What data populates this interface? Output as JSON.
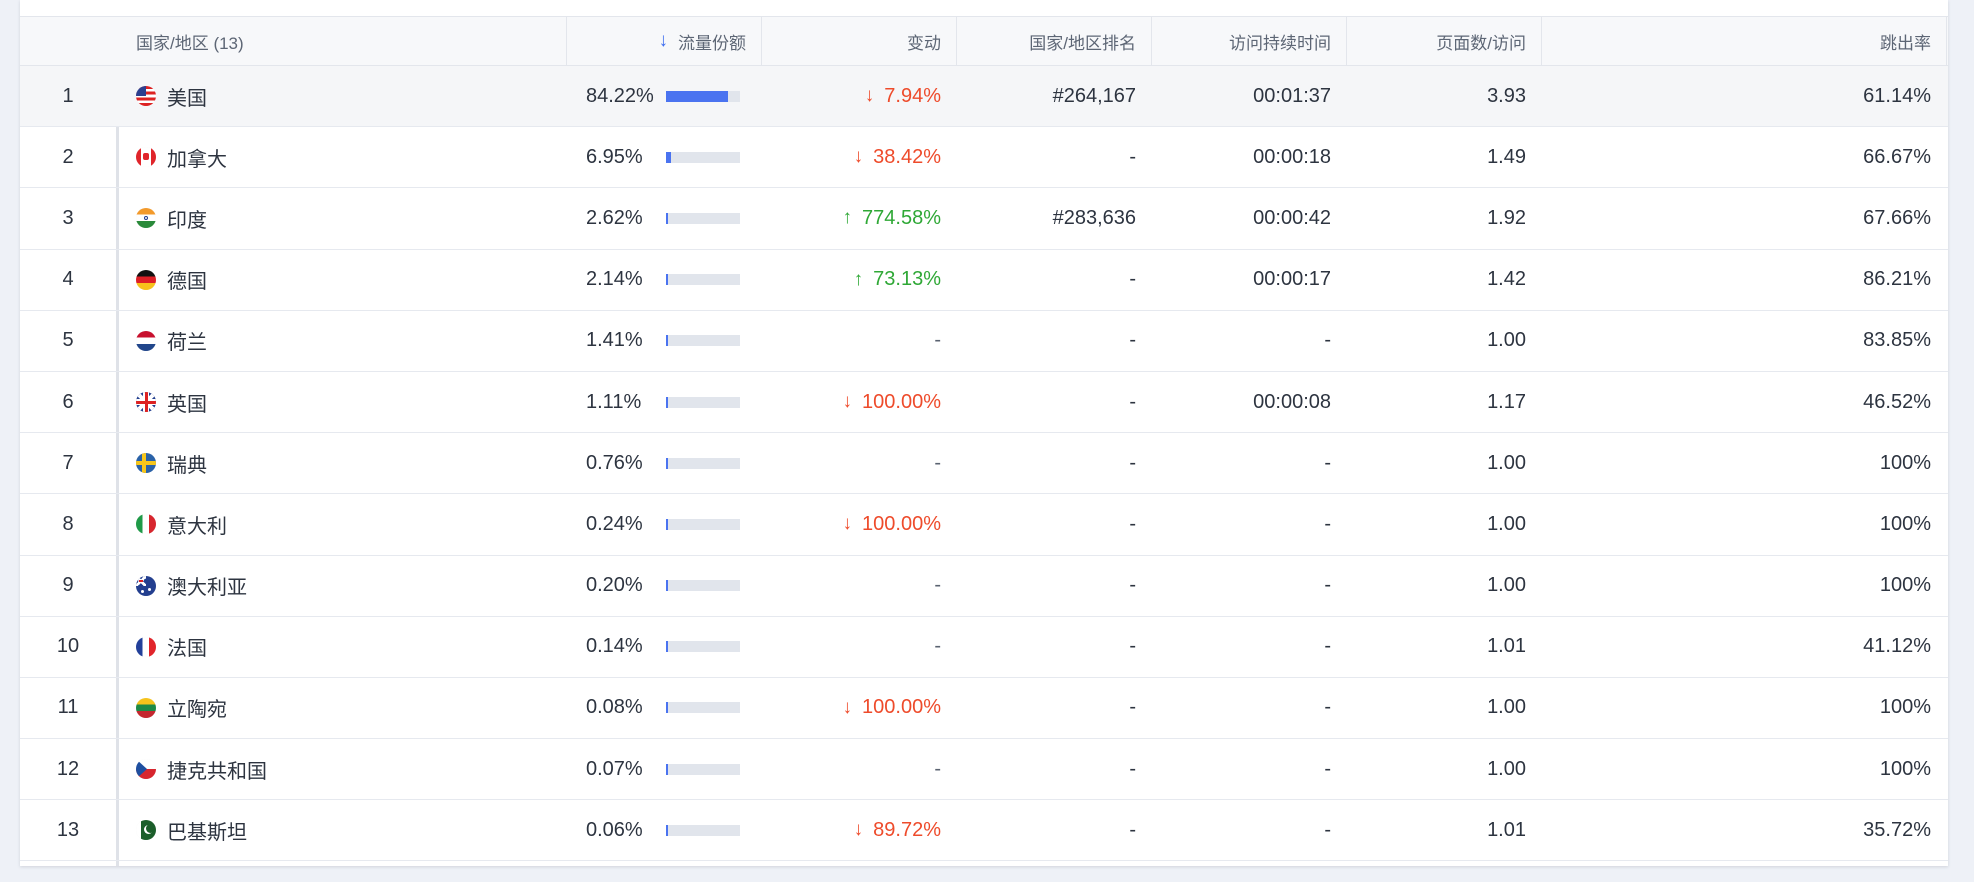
{
  "table": {
    "headers": {
      "country": "国家/地区 (13)",
      "traffic_share": "流量份额",
      "change": "变动",
      "country_rank": "国家/地区排名",
      "visit_duration": "访问持续时间",
      "pages_per_visit": "页面数/访问",
      "bounce_rate": "跳出率"
    },
    "sort_icon": "arrow-down-icon",
    "colors": {
      "bar": "#4a73f0",
      "down": "#ee4b2b",
      "up": "#2fa836"
    },
    "rows": [
      {
        "rank": "1",
        "country": "美国",
        "flag": "us-flag-icon",
        "share": "84.22%",
        "share_value": 84.22,
        "change": "7.94%",
        "dir": "down",
        "country_rank": "#264,167",
        "duration": "00:01:37",
        "pages": "3.93",
        "bounce": "61.14%"
      },
      {
        "rank": "2",
        "country": "加拿大",
        "flag": "canada-flag-icon",
        "share": "6.95%",
        "share_value": 6.95,
        "change": "38.42%",
        "dir": "down",
        "country_rank": "-",
        "duration": "00:00:18",
        "pages": "1.49",
        "bounce": "66.67%"
      },
      {
        "rank": "3",
        "country": "印度",
        "flag": "india-flag-icon",
        "share": "2.62%",
        "share_value": 2.62,
        "change": "774.58%",
        "dir": "up",
        "country_rank": "#283,636",
        "duration": "00:00:42",
        "pages": "1.92",
        "bounce": "67.66%"
      },
      {
        "rank": "4",
        "country": "德国",
        "flag": "germany-flag-icon",
        "share": "2.14%",
        "share_value": 2.14,
        "change": "73.13%",
        "dir": "up",
        "country_rank": "-",
        "duration": "00:00:17",
        "pages": "1.42",
        "bounce": "86.21%"
      },
      {
        "rank": "5",
        "country": "荷兰",
        "flag": "netherlands-flag-icon",
        "share": "1.41%",
        "share_value": 1.41,
        "change": "-",
        "dir": "none",
        "country_rank": "-",
        "duration": "-",
        "pages": "1.00",
        "bounce": "83.85%"
      },
      {
        "rank": "6",
        "country": "英国",
        "flag": "uk-flag-icon",
        "share": "1.11%",
        "share_value": 1.11,
        "change": "100.00%",
        "dir": "down",
        "country_rank": "-",
        "duration": "00:00:08",
        "pages": "1.17",
        "bounce": "46.52%"
      },
      {
        "rank": "7",
        "country": "瑞典",
        "flag": "sweden-flag-icon",
        "share": "0.76%",
        "share_value": 0.76,
        "change": "-",
        "dir": "none",
        "country_rank": "-",
        "duration": "-",
        "pages": "1.00",
        "bounce": "100%"
      },
      {
        "rank": "8",
        "country": "意大利",
        "flag": "italy-flag-icon",
        "share": "0.24%",
        "share_value": 0.24,
        "change": "100.00%",
        "dir": "down",
        "country_rank": "-",
        "duration": "-",
        "pages": "1.00",
        "bounce": "100%"
      },
      {
        "rank": "9",
        "country": "澳大利亚",
        "flag": "australia-flag-icon",
        "share": "0.20%",
        "share_value": 0.2,
        "change": "-",
        "dir": "none",
        "country_rank": "-",
        "duration": "-",
        "pages": "1.00",
        "bounce": "100%"
      },
      {
        "rank": "10",
        "country": "法国",
        "flag": "france-flag-icon",
        "share": "0.14%",
        "share_value": 0.14,
        "change": "-",
        "dir": "none",
        "country_rank": "-",
        "duration": "-",
        "pages": "1.01",
        "bounce": "41.12%"
      },
      {
        "rank": "11",
        "country": "立陶宛",
        "flag": "lithuania-flag-icon",
        "share": "0.08%",
        "share_value": 0.08,
        "change": "100.00%",
        "dir": "down",
        "country_rank": "-",
        "duration": "-",
        "pages": "1.00",
        "bounce": "100%"
      },
      {
        "rank": "12",
        "country": "捷克共和国",
        "flag": "czech-flag-icon",
        "share": "0.07%",
        "share_value": 0.07,
        "change": "-",
        "dir": "none",
        "country_rank": "-",
        "duration": "-",
        "pages": "1.00",
        "bounce": "100%"
      },
      {
        "rank": "13",
        "country": "巴基斯坦",
        "flag": "pakistan-flag-icon",
        "share": "0.06%",
        "share_value": 0.06,
        "change": "89.72%",
        "dir": "down",
        "country_rank": "-",
        "duration": "-",
        "pages": "1.01",
        "bounce": "35.72%"
      }
    ]
  }
}
